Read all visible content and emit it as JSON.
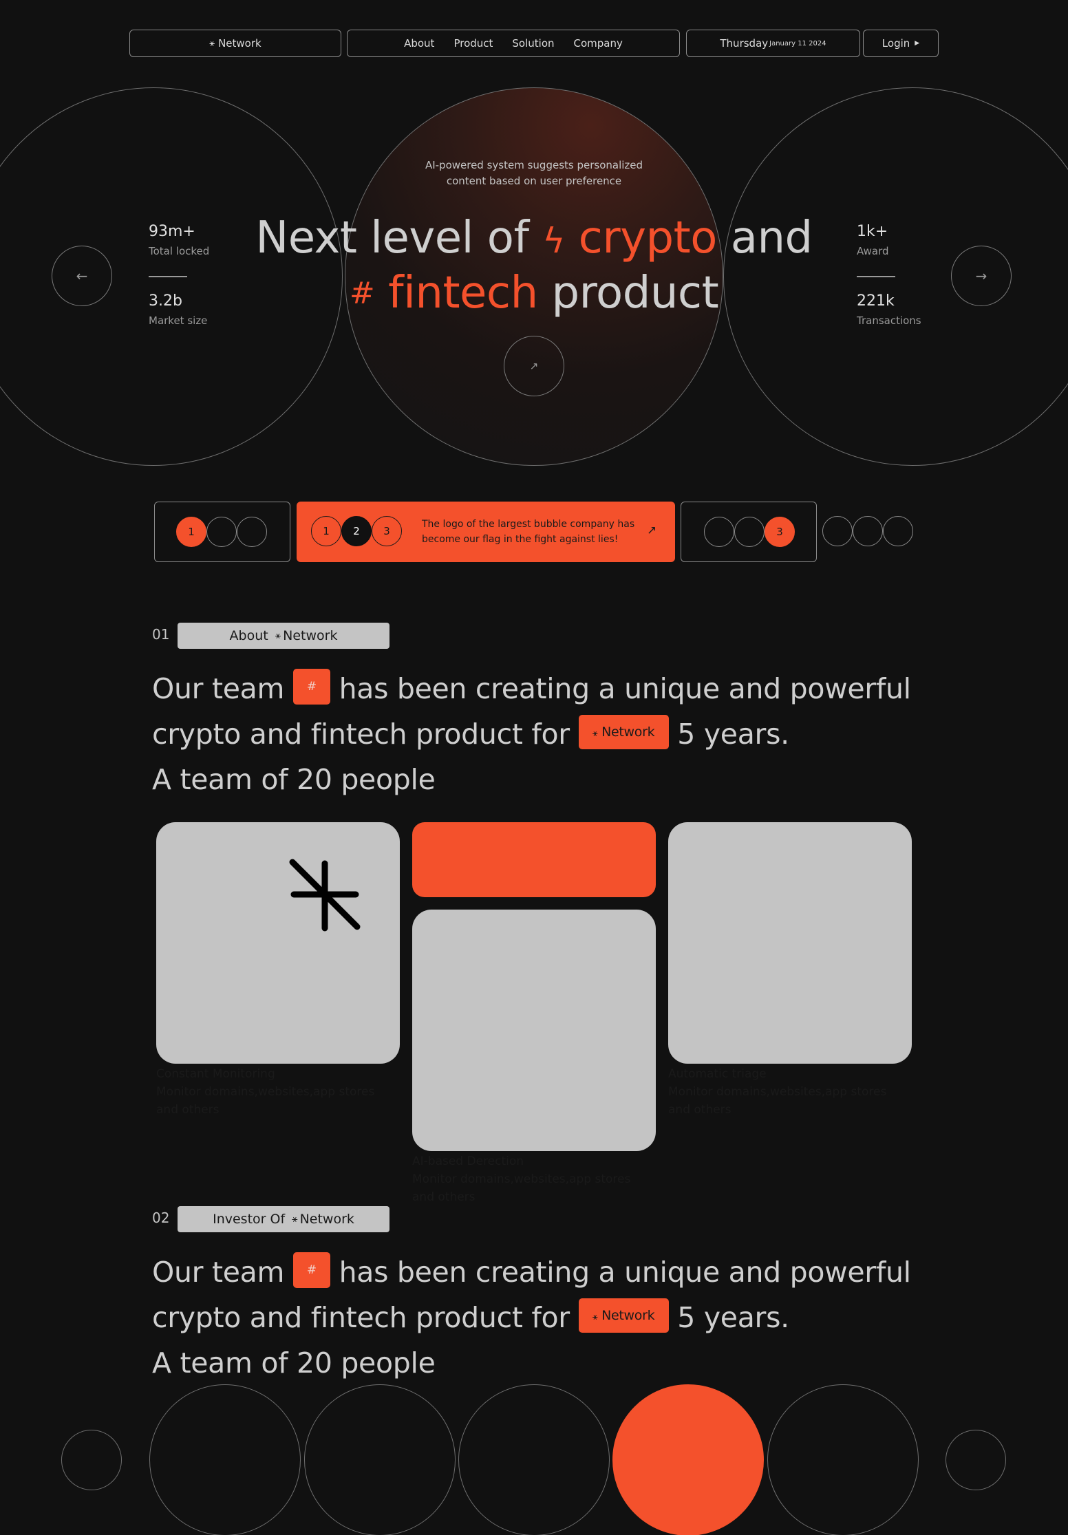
{
  "header": {
    "brand": "Network",
    "nav": [
      "About",
      "Product",
      "Solution",
      "Company"
    ],
    "date_day": "Thursday",
    "date_full": "January 11 2024",
    "login": "Login"
  },
  "hero": {
    "subtitle_line1": "AI-powered system suggests personalized",
    "subtitle_line2": "content based on user preference",
    "title_part1": "Next level of",
    "title_accent1": "crypto",
    "title_part2": "and",
    "title_accent2": "fintech",
    "title_part3": "product",
    "stats_left": [
      {
        "value": "93m+",
        "label": "Total locked"
      },
      {
        "value": "3.2b",
        "label": "Market size"
      }
    ],
    "stats_right": [
      {
        "value": "1k+",
        "label": "Award"
      },
      {
        "value": "221k",
        "label": "Transactions"
      }
    ]
  },
  "steps": {
    "box1": [
      "1"
    ],
    "box2": [
      "1",
      "2",
      "3"
    ],
    "box2_text_line1": "The logo of the largest bubble company has",
    "box2_text_line2": "become our flag in the fight against lies!",
    "box3": [
      "3"
    ]
  },
  "section1": {
    "number": "01",
    "tag": "About",
    "tag_brand": "Network",
    "text_a": "Our team",
    "text_b": "has been creating a unique and powerful",
    "text_c": "crypto and fintech product for",
    "inline_brand": "Network",
    "text_d": "5 years.",
    "text_e": "A team of 20 people",
    "cards": [
      {
        "title": "Constant Monitoring",
        "desc1": "Monitor domains,websites,app stores",
        "desc2": "and others"
      },
      {
        "title": "AI-based Derection",
        "desc1": "Monitor domains,websites,app stores",
        "desc2": "and others"
      },
      {
        "title": "Automatic triage",
        "desc1": "Monitor domains,websites,app stores",
        "desc2": "and others"
      }
    ]
  },
  "section2": {
    "number": "02",
    "tag": "Investor Of",
    "tag_brand": "Network",
    "text_a": "Our team",
    "text_b": "has been creating a unique and powerful",
    "text_c": "crypto and fintech product for",
    "inline_brand": "Network",
    "text_d": "5 years.",
    "text_e": "A team of 20 people"
  },
  "colors": {
    "accent": "#f4512c",
    "background": "#111111",
    "card": "#c4c4c4"
  }
}
